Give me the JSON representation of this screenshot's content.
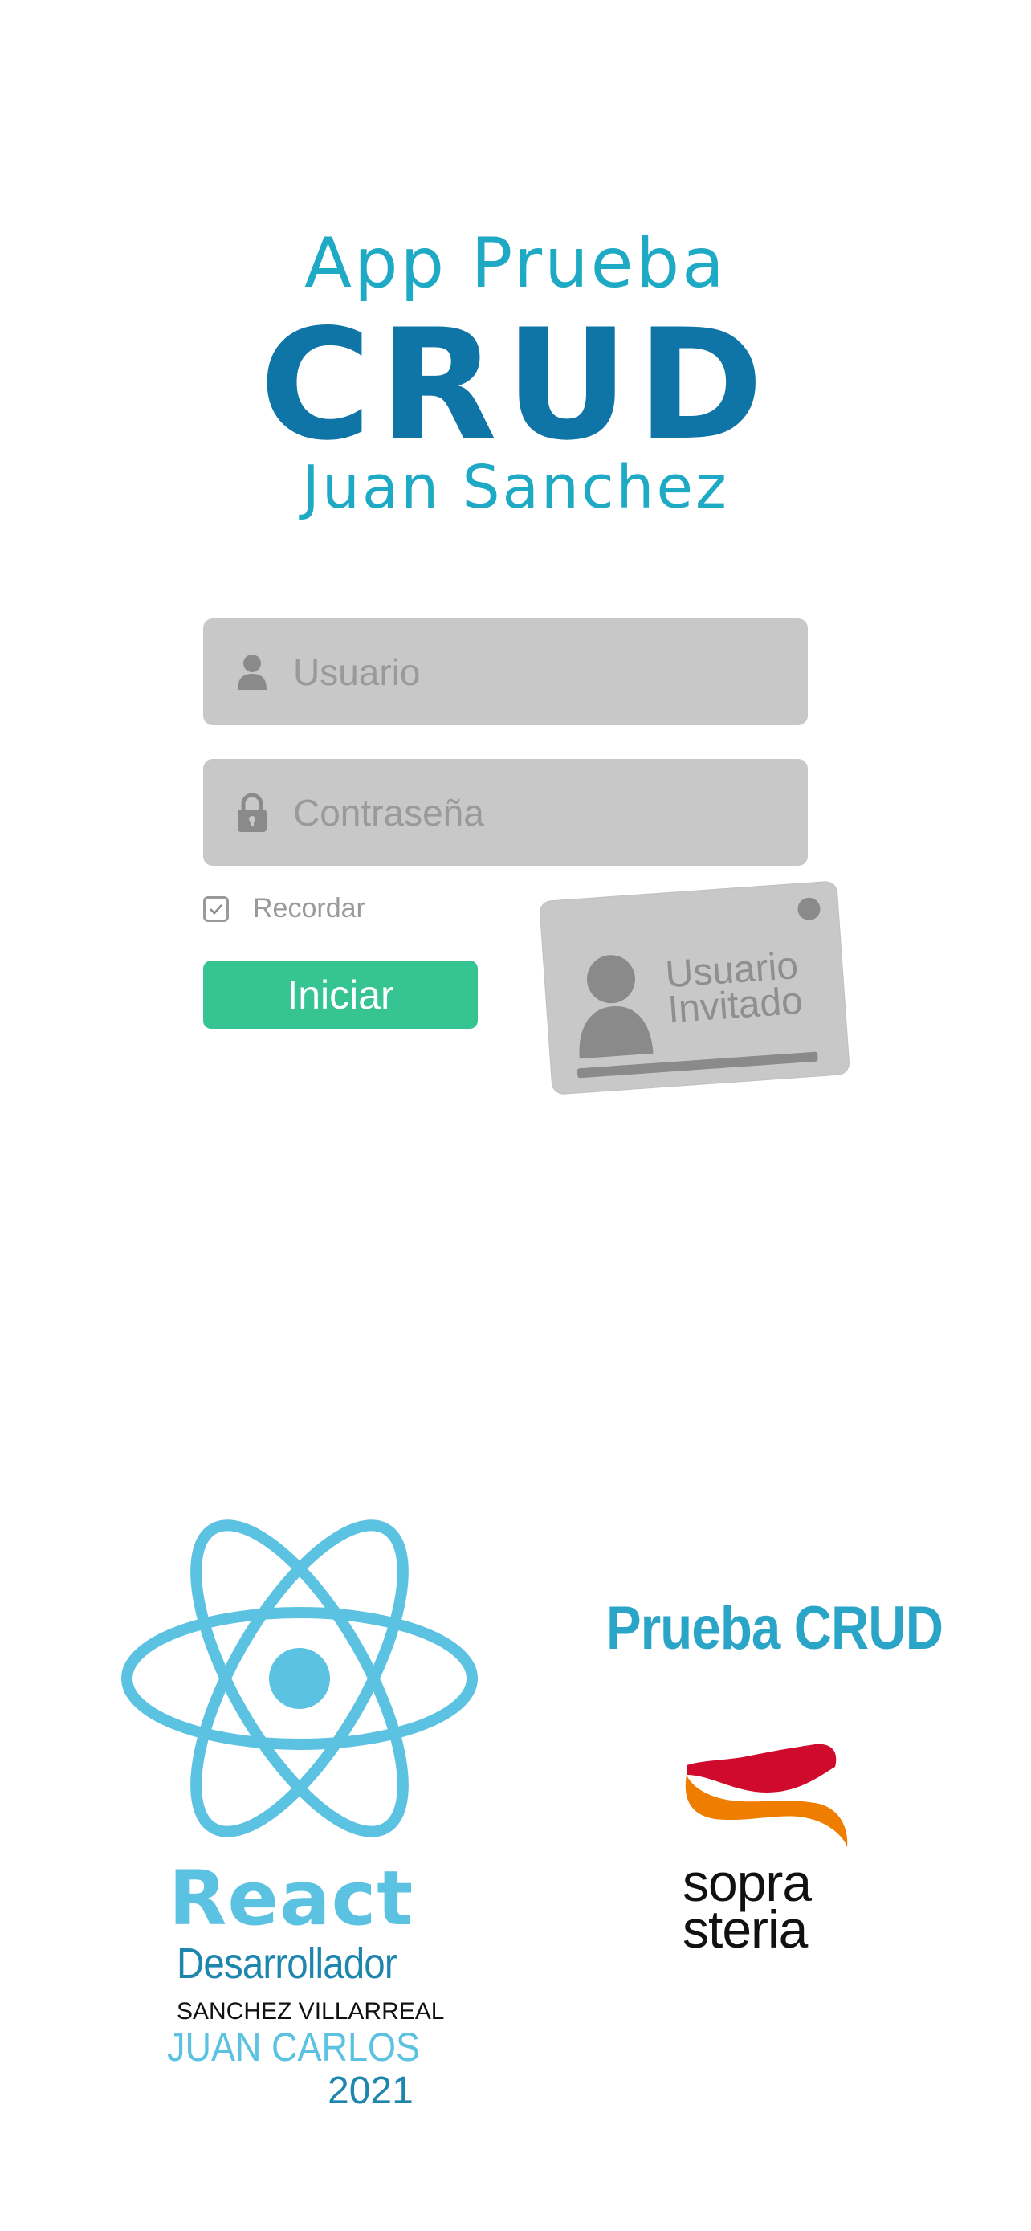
{
  "header": {
    "line1": "App Prueba",
    "line2": "CRUD",
    "line3": "Juan Sanchez"
  },
  "login": {
    "username_placeholder": "Usuario",
    "password_placeholder": "Contraseña",
    "remember_label": "Recordar",
    "remember_checked": true,
    "submit_label": "Iniciar",
    "guest_line1": "Usuario",
    "guest_line2": "Invitado"
  },
  "footer": {
    "react_word": "React",
    "developer_title": "Desarrollador",
    "developer_surname": "SANCHEZ VILLARREAL",
    "developer_name": "JUAN CARLOS",
    "year": "2021",
    "project_label": "Prueba CRUD",
    "company_line1": "sopra",
    "company_line2": "steria"
  },
  "colors": {
    "title_light": "#1ea9c4",
    "title_dark": "#0f74a6",
    "field_bg": "#c8c8c8",
    "button_green": "#36c592",
    "react_blue": "#5bc2e1",
    "sopra_red": "#cf0a2c",
    "sopra_orange": "#ef7d00"
  },
  "icons": {
    "username": "user-icon",
    "password": "lock-icon",
    "remember": "checkbox-check-icon",
    "react": "react-logo-icon",
    "sopra": "sopra-steria-logo-icon"
  }
}
